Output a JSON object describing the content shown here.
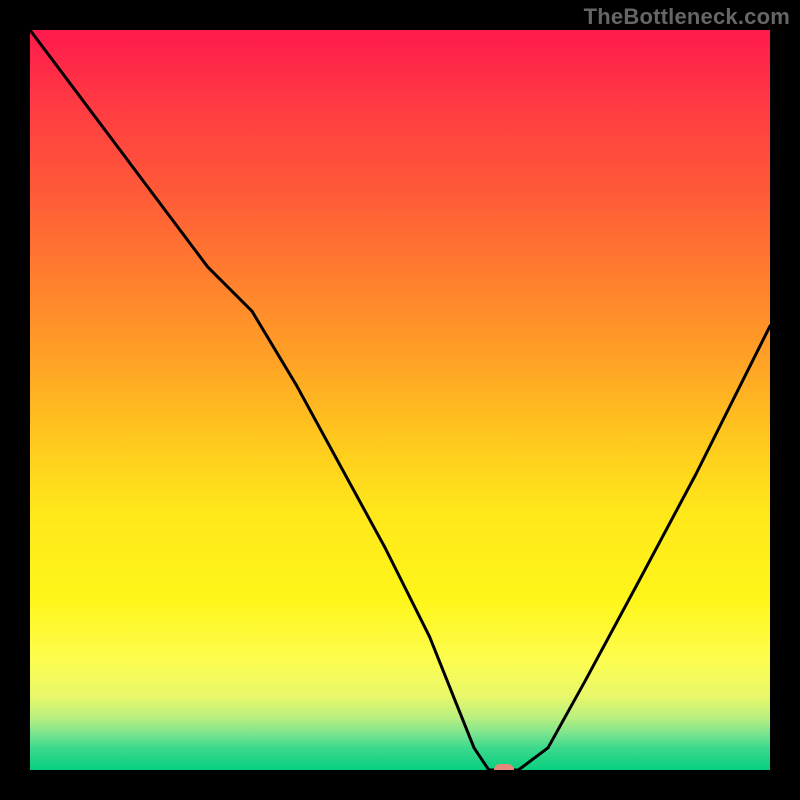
{
  "watermark": "TheBottleneck.com",
  "chart_data": {
    "type": "line",
    "title": "",
    "xlabel": "",
    "ylabel": "",
    "xlim": [
      0,
      100
    ],
    "ylim": [
      0,
      100
    ],
    "grid": false,
    "legend": false,
    "series": [
      {
        "name": "curve",
        "color": "#000000",
        "x": [
          0,
          6,
          12,
          18,
          24,
          30,
          36,
          42,
          48,
          54,
          60,
          62,
          66,
          70,
          75,
          82,
          90,
          100
        ],
        "values": [
          100,
          92,
          84,
          76,
          68,
          62,
          52,
          41,
          30,
          18,
          3,
          0,
          0,
          3,
          12,
          25,
          40,
          60
        ]
      }
    ],
    "marker": {
      "x": 64,
      "y": 0,
      "color": "#e9897b"
    },
    "background_gradient": {
      "stops": [
        {
          "pct": 0,
          "color": "#ff1a4c"
        },
        {
          "pct": 25,
          "color": "#ff6a34"
        },
        {
          "pct": 50,
          "color": "#ffbb20"
        },
        {
          "pct": 75,
          "color": "#fff61a"
        },
        {
          "pct": 100,
          "color": "#07cf80"
        }
      ]
    }
  }
}
